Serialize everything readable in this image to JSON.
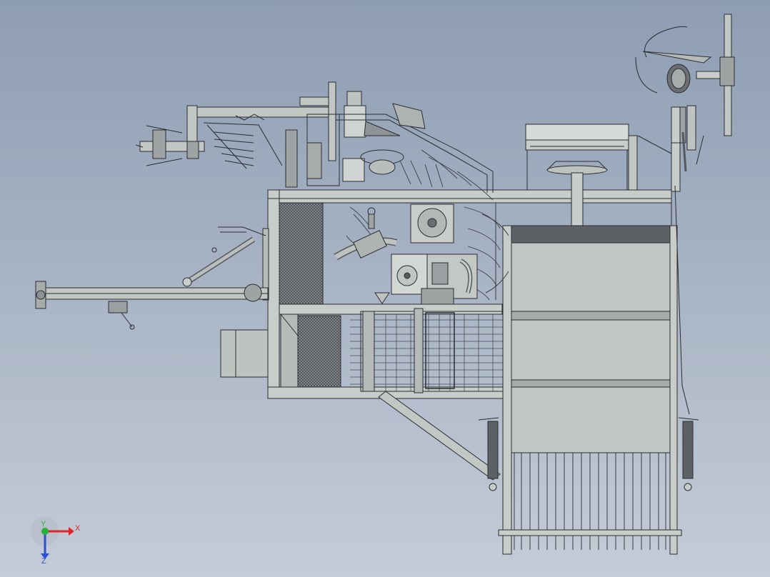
{
  "viewport": {
    "background_top": "#8e9db3",
    "background_bottom": "#c4ccd7"
  },
  "model": {
    "line_color": "#2a2d31",
    "body_fill": "#c7cbc8",
    "panel_fill": "#b9bfbc",
    "dark_fill": "#5d6166",
    "mesh_fill": "#6b6f73"
  },
  "triad": {
    "x_label": "X",
    "y_label": "Y",
    "z_label": "Z",
    "x_color": "#e0242c",
    "y_color": "#27b338",
    "z_color": "#2b4fd6"
  }
}
